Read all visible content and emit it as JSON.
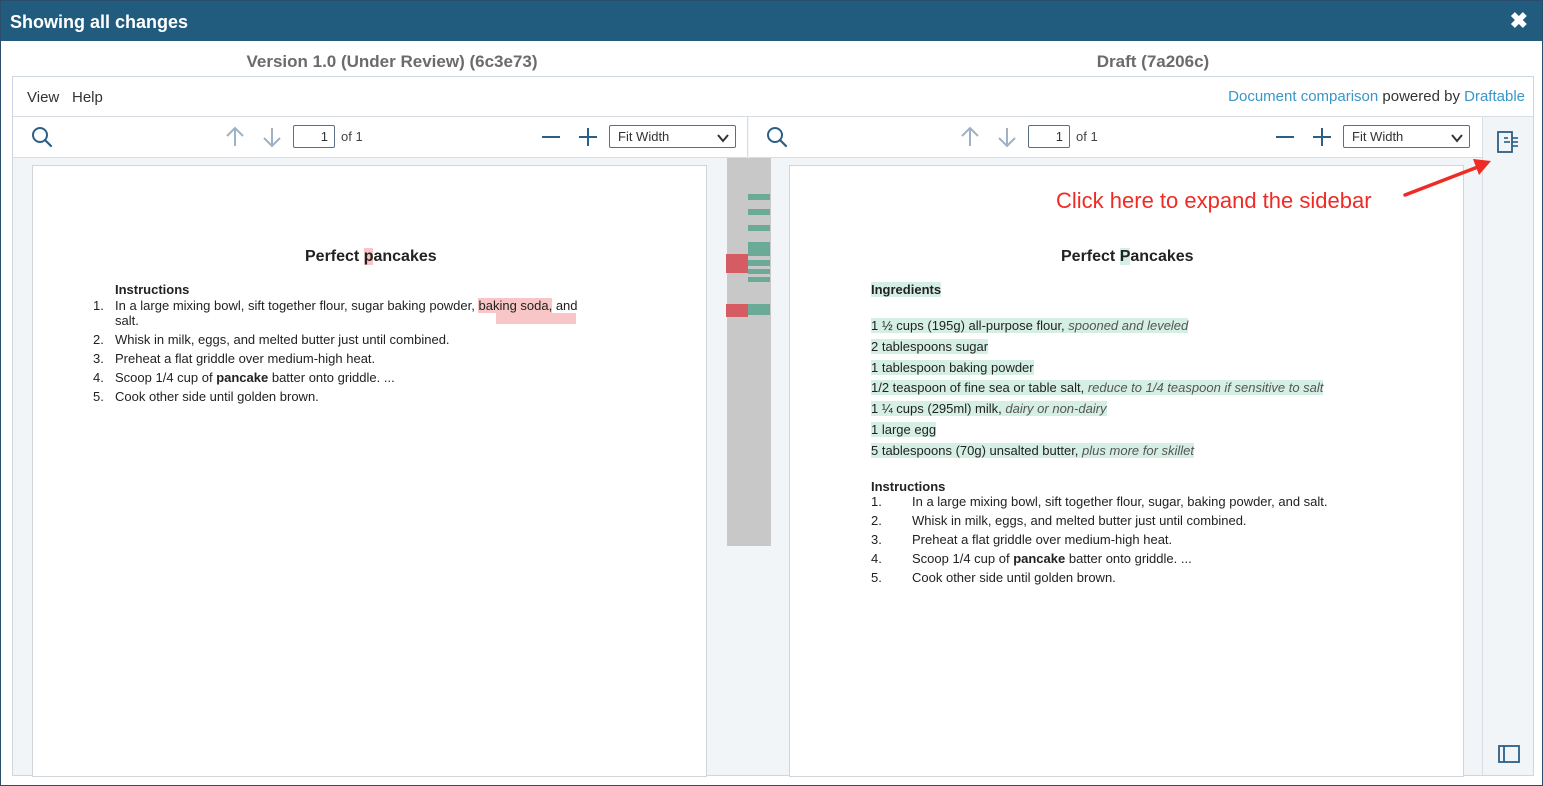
{
  "window": {
    "title": "Showing all changes",
    "close_glyph": "✖"
  },
  "left": {
    "version_title": "Version 1.0 (Under Review) (6c3e73)",
    "page_value": "1",
    "page_of": "of 1",
    "zoom": "Fit Width",
    "doc": {
      "title_pre": "Perfect ",
      "title_changed": "p",
      "title_post": "ancakes",
      "section": "Instructions",
      "items": [
        {
          "num": "1.",
          "pre": "In a large mixing bowl, sift together flour, sugar baking powder, ",
          "deleted": "baking soda,",
          "post": " and",
          "line2": "salt."
        },
        {
          "num": "2.",
          "text": "Whisk in milk, eggs, and melted butter just until combined."
        },
        {
          "num": "3.",
          "text": "Preheat a flat griddle over medium-high heat."
        },
        {
          "num": "4.",
          "pre": "Scoop 1/4 cup of ",
          "bold": "pancake",
          "post": " batter onto griddle. ..."
        },
        {
          "num": "5.",
          "text": "Cook other side until golden brown."
        }
      ]
    }
  },
  "right": {
    "version_title": "Draft (7a206c)",
    "page_value": "1",
    "page_of": "of 1",
    "zoom": "Fit Width",
    "doc": {
      "title_pre": "Perfect ",
      "title_changed": "P",
      "title_post": "ancakes",
      "ingredients_heading": "Ingredients",
      "ingredients": [
        {
          "main": "1 ½ cups (195g) all-purpose flour, ",
          "note": "spooned and leveled"
        },
        {
          "main": "2 tablespoons sugar",
          "note": ""
        },
        {
          "main": "1 tablespoon baking powder",
          "note": ""
        },
        {
          "main": "1/2 teaspoon of fine sea or table salt, ",
          "note": "reduce to 1/4 teaspoon if sensitive to salt"
        },
        {
          "main": "1 ¼ cups (295ml) milk, ",
          "note": "dairy or non-dairy"
        },
        {
          "main": "1 large egg",
          "note": ""
        },
        {
          "main": "5 tablespoons (70g) unsalted butter, ",
          "note": "plus more for skillet"
        }
      ],
      "section": "Instructions",
      "items": [
        {
          "num": "1.",
          "text": "In a large mixing bowl, sift together flour, sugar, baking powder, and salt."
        },
        {
          "num": "2.",
          "text": "Whisk in milk, eggs, and melted butter just until combined."
        },
        {
          "num": "3.",
          "text": "Preheat a flat griddle over medium-high heat."
        },
        {
          "num": "4.",
          "pre": "Scoop 1/4 cup of ",
          "bold": "pancake",
          "post": " batter onto griddle. ..."
        },
        {
          "num": "5.",
          "text": "Cook other side until golden brown."
        }
      ]
    }
  },
  "menu": {
    "view": "View",
    "help": "Help"
  },
  "powered": {
    "link1": "Document comparison",
    "mid": " powered by ",
    "link2": "Draftable"
  },
  "annotation": "Click here to expand the sidebar",
  "colors": {
    "titlebar": "#215c7f",
    "deleted": "#f8c6c6",
    "inserted": "#d6efe5",
    "link": "#3a96c8",
    "annotation": "#ee2b24",
    "mark_del": "#d55c63",
    "mark_ins": "#6aaa96"
  },
  "icons": {
    "search": "search-icon",
    "up": "arrow-up-icon",
    "down": "arrow-down-icon",
    "zoom_out": "minus-icon",
    "zoom_in": "plus-icon",
    "sidebar": "expand-sidebar-icon",
    "panel": "panel-toggle-icon"
  }
}
